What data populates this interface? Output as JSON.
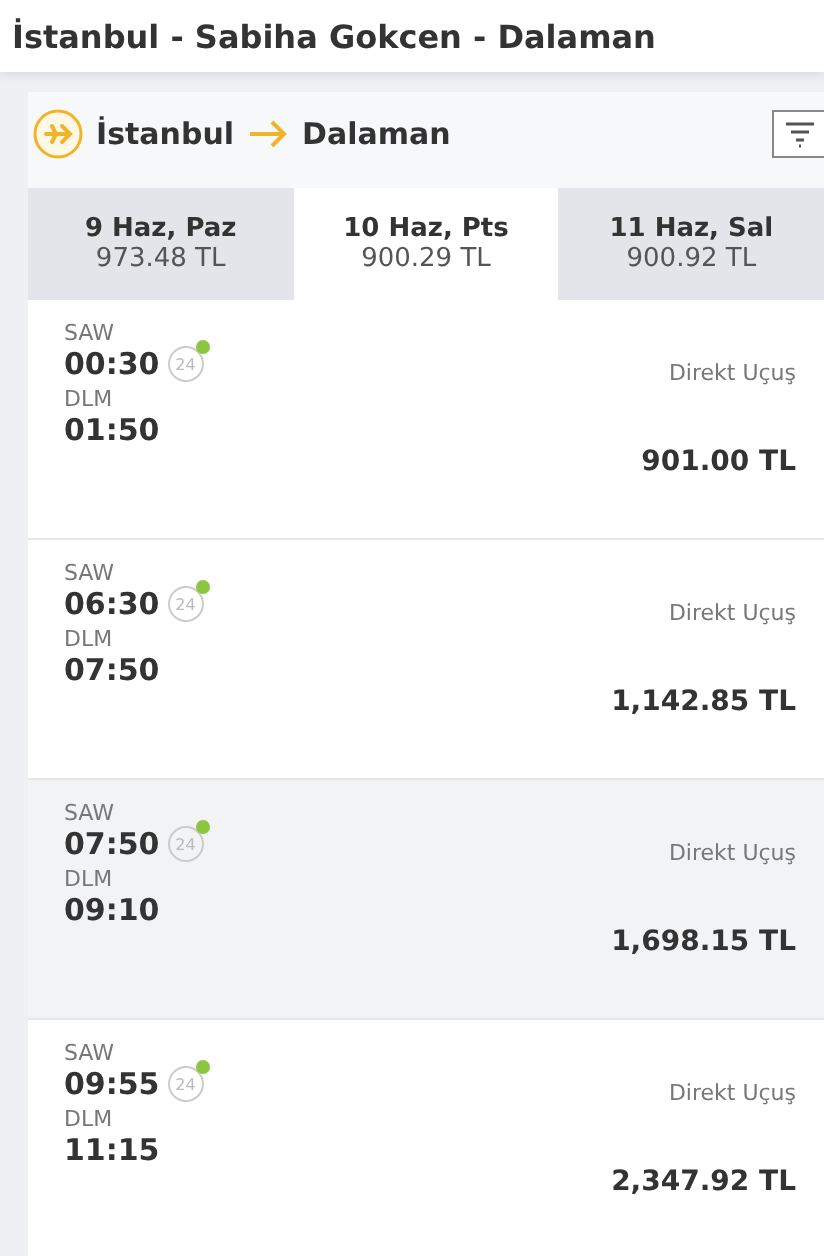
{
  "page_title": "İstanbul - Sabiha Gokcen  -  Dalaman",
  "route": {
    "from": "İstanbul",
    "to": "Dalaman"
  },
  "date_tabs": [
    {
      "date": "9 Haz, Paz",
      "price": "973.48 TL",
      "selected": false
    },
    {
      "date": "10 Haz, Pts",
      "price": "900.29 TL",
      "selected": true
    },
    {
      "date": "11 Haz, Sal",
      "price": "900.92 TL",
      "selected": false
    }
  ],
  "flights": [
    {
      "origin": "SAW",
      "departure": "00:30",
      "badge": "24",
      "destination": "DLM",
      "arrival": "01:50",
      "type": "Direkt Uçuş",
      "price": "901.00 TL",
      "selected": false
    },
    {
      "origin": "SAW",
      "departure": "06:30",
      "badge": "24",
      "destination": "DLM",
      "arrival": "07:50",
      "type": "Direkt Uçuş",
      "price": "1,142.85 TL",
      "selected": false
    },
    {
      "origin": "SAW",
      "departure": "07:50",
      "badge": "24",
      "destination": "DLM",
      "arrival": "09:10",
      "type": "Direkt Uçuş",
      "price": "1,698.15 TL",
      "selected": true
    },
    {
      "origin": "SAW",
      "departure": "09:55",
      "badge": "24",
      "destination": "DLM",
      "arrival": "11:15",
      "type": "Direkt Uçuş",
      "price": "2,347.92 TL",
      "selected": false
    }
  ]
}
